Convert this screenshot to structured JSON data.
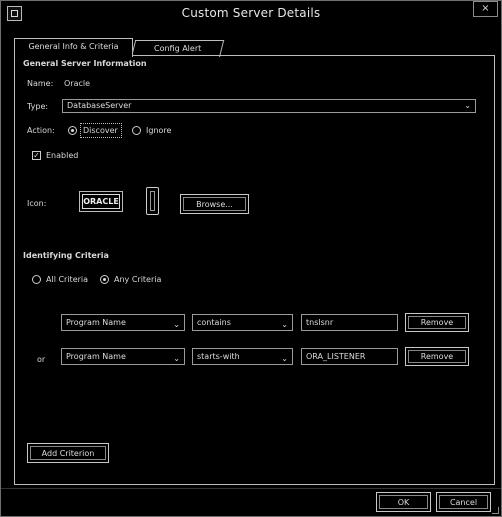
{
  "window": {
    "title": "Custom Server Details",
    "close_glyph": "×"
  },
  "tabs": [
    {
      "label": "General Info & Criteria"
    },
    {
      "label": "Config Alert"
    }
  ],
  "general": {
    "section_title": "General Server Information",
    "name_label": "Name:",
    "name_value": "Oracle",
    "type_label": "Type:",
    "type_value": "DatabaseServer",
    "action_label": "Action:",
    "action_options": [
      {
        "label": "Discover",
        "selected": true
      },
      {
        "label": "Ignore",
        "selected": false
      }
    ],
    "enabled_label": "Enabled",
    "enabled_checked": true,
    "icon_label": "Icon:",
    "icon_text": "ORACLE",
    "browse_label": "Browse..."
  },
  "criteria": {
    "section_title": "Identifying Criteria",
    "match_options": [
      {
        "label": "All Criteria",
        "selected": false
      },
      {
        "label": "Any Criteria",
        "selected": true
      }
    ],
    "rows": [
      {
        "prefix": "",
        "field": "Program Name",
        "operator": "contains",
        "value": "tnslsnr",
        "remove_label": "Remove"
      },
      {
        "prefix": "or",
        "field": "Program Name",
        "operator": "starts-with",
        "value": "ORA_LISTENER",
        "remove_label": "Remove"
      }
    ],
    "add_label": "Add Criterion"
  },
  "footer": {
    "ok_label": "OK",
    "cancel_label": "Cancel"
  }
}
